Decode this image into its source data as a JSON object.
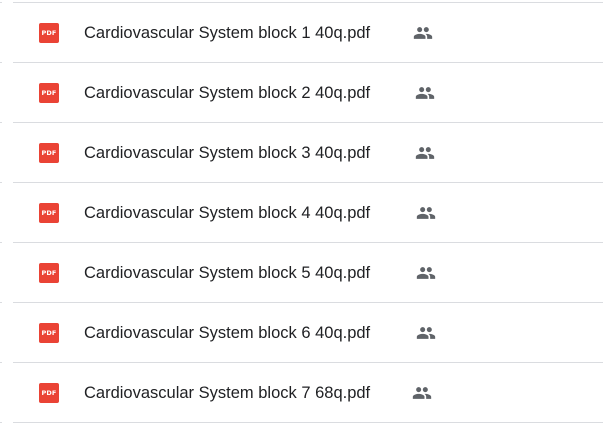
{
  "files": [
    {
      "name": "Cardiovascular System block 1 40q.pdf",
      "type_badge": "PDF",
      "icon": "pdf-icon",
      "shared_icon": "people-icon"
    },
    {
      "name": "Cardiovascular System block 2 40q.pdf",
      "type_badge": "PDF",
      "icon": "pdf-icon",
      "shared_icon": "people-icon"
    },
    {
      "name": "Cardiovascular System block 3 40q.pdf",
      "type_badge": "PDF",
      "icon": "pdf-icon",
      "shared_icon": "people-icon"
    },
    {
      "name": "Cardiovascular System block 4 40q.pdf",
      "type_badge": "PDF",
      "icon": "pdf-icon",
      "shared_icon": "people-icon"
    },
    {
      "name": "Cardiovascular System block 5 40q.pdf",
      "type_badge": "PDF",
      "icon": "pdf-icon",
      "shared_icon": "people-icon"
    },
    {
      "name": "Cardiovascular System block 6 40q.pdf",
      "type_badge": "PDF",
      "icon": "pdf-icon",
      "shared_icon": "people-icon"
    },
    {
      "name": "Cardiovascular System block 7 68q.pdf",
      "type_badge": "PDF",
      "icon": "pdf-icon",
      "shared_icon": "people-icon"
    }
  ],
  "colors": {
    "pdf_red": "#ea4335",
    "text": "#202124",
    "icon_gray": "#5f6368",
    "divider": "#dadce0"
  }
}
